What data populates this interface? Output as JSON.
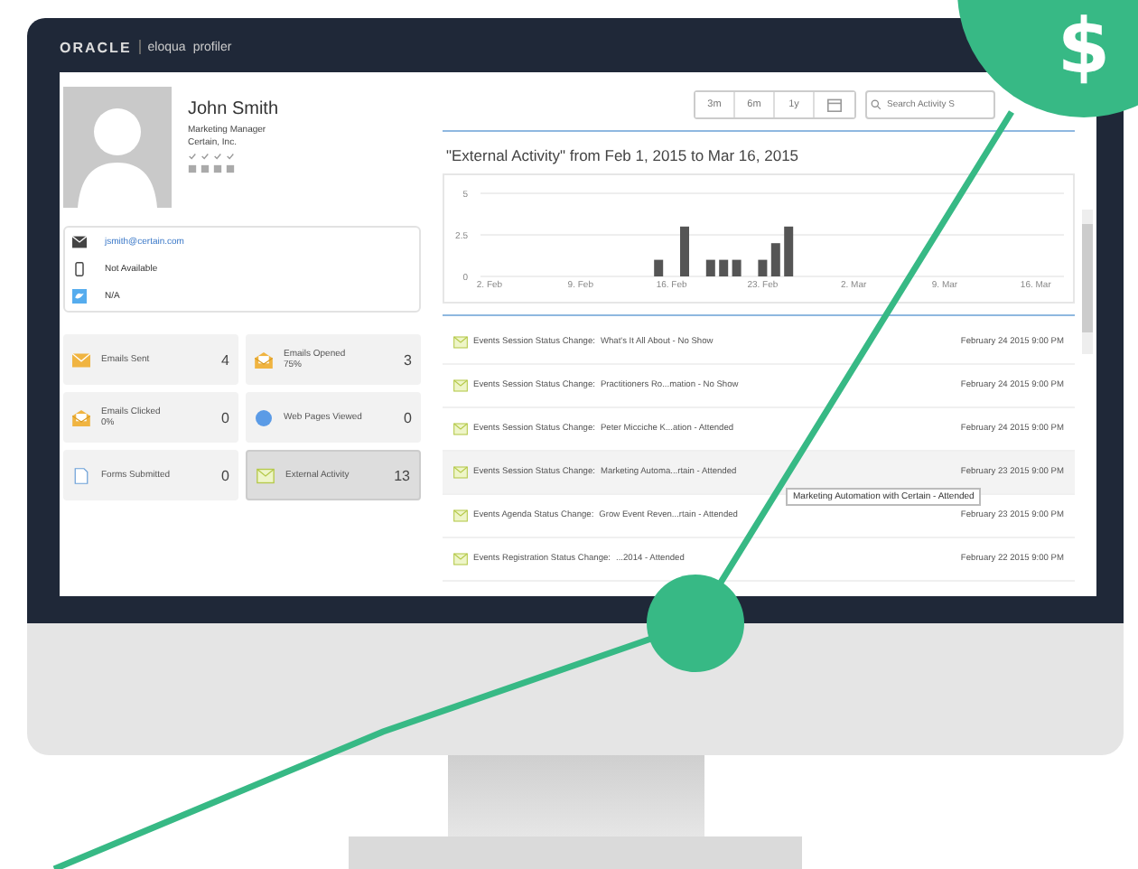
{
  "header": {
    "brand": "ORACLE",
    "product": "eloqua",
    "module": "profiler"
  },
  "profile": {
    "name": "John Smith",
    "title": "Marketing Manager",
    "company": "Certain, Inc."
  },
  "contact": [
    {
      "kind": "email",
      "text": "jsmith@certain.com"
    },
    {
      "kind": "phone",
      "text": "Not Available"
    },
    {
      "kind": "twitter",
      "text": "N/A"
    }
  ],
  "stats": [
    {
      "kind": "sent",
      "label": "Emails Sent",
      "count": "4",
      "selected": false
    },
    {
      "kind": "opened",
      "label": "Emails Opened",
      "rate": "75%",
      "count": "3",
      "selected": false
    },
    {
      "kind": "clicked",
      "label": "Emails Clicked",
      "rate": "0%",
      "count": "0",
      "selected": false
    },
    {
      "kind": "web",
      "label": "Web Pages Viewed",
      "count": "0",
      "selected": false
    },
    {
      "kind": "form",
      "label": "Forms Submitted",
      "count": "0",
      "selected": false
    },
    {
      "kind": "external",
      "label": "External Activity",
      "count": "13",
      "selected": true
    }
  ],
  "range_buttons": [
    "3m",
    "6m",
    "1y"
  ],
  "search": {
    "placeholder": "Search Activity S"
  },
  "activity": {
    "title": "\"External Activity\" from Feb 1, 2015 to Mar 16, 2015",
    "chart_data": {
      "type": "bar",
      "ylim": [
        0,
        5
      ],
      "yticks": [
        0,
        2.5,
        5
      ],
      "categories": [
        null,
        "2. Feb",
        null,
        null,
        null,
        null,
        null,
        null,
        "9. Feb",
        null,
        null,
        null,
        null,
        null,
        null,
        "16. Feb",
        null,
        null,
        null,
        null,
        null,
        null,
        "23. Feb",
        null,
        null,
        null,
        null,
        null,
        null,
        "2. Mar",
        null,
        null,
        null,
        null,
        null,
        null,
        "9. Mar",
        null,
        null,
        null,
        null,
        null,
        null,
        "16. Mar"
      ],
      "values": [
        null,
        null,
        null,
        null,
        null,
        null,
        null,
        null,
        null,
        null,
        null,
        null,
        null,
        null,
        1,
        null,
        3,
        null,
        1,
        1,
        1,
        null,
        1,
        2,
        3,
        null,
        null,
        null,
        null,
        null,
        null,
        null,
        null,
        null,
        null,
        null,
        null,
        null,
        null,
        null,
        null,
        null,
        null,
        null
      ]
    }
  },
  "rows": [
    {
      "type": "Events Session Status Change:",
      "detail": "What's It All About - No Show",
      "date": "February 24 2015 9:00 PM",
      "highlighted": false
    },
    {
      "type": "Events Session Status Change:",
      "detail": "Practitioners Ro...mation - No Show",
      "date": "February 24 2015 9:00 PM",
      "highlighted": false
    },
    {
      "type": "Events Session Status Change:",
      "detail": "Peter Micciche K...ation - Attended",
      "date": "February 24 2015 9:00 PM",
      "highlighted": false
    },
    {
      "type": "Events Session Status Change:",
      "detail": "Marketing Automa...rtain - Attended",
      "date": "February 23 2015 9:00 PM",
      "highlighted": true
    },
    {
      "type": "Events Agenda Status Change:",
      "detail": "Grow Event Reven...rtain - Attended",
      "date": "February 23 2015 9:00 PM",
      "highlighted": false
    },
    {
      "type": "Events Registration Status Change:",
      "detail": "...2014 - Attended",
      "date": "February 22 2015 9:00 PM",
      "highlighted": false
    }
  ],
  "tooltip": "Marketing Automation with Certain - Attended",
  "badge": {
    "symbol": "$"
  }
}
